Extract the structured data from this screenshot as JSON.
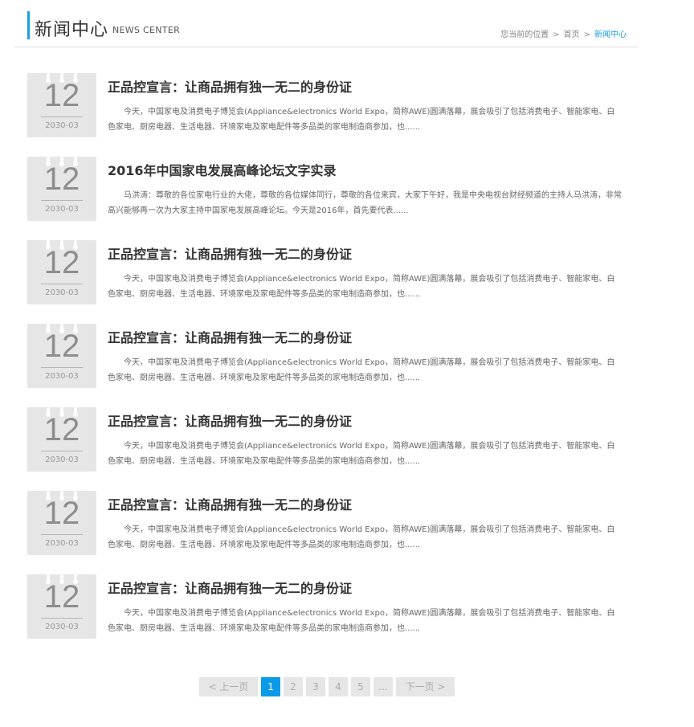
{
  "header": {
    "title": "新闻中心",
    "subtitle": "NEWS CENTER",
    "breadcrumb": {
      "location_label": "您当前的位置",
      "separator": ">",
      "home": "首页",
      "current": "新闻中心"
    }
  },
  "news": [
    {
      "day": "12",
      "year_month": "2030-03",
      "title": "正品控宣言：让商品拥有独一无二的身份证",
      "summary": "今天，中国家电及消费电子博览会(Appliance&electronics World Expo，简称AWE)圆满落幕，展会吸引了包括消费电子、智能家电、白色家电、厨房电器、生活电器、环境家电及家电配件等多品类的家电制造商参加，也......"
    },
    {
      "day": "12",
      "year_month": "2030-03",
      "title": "2016年中国家电发展高峰论坛文字实录",
      "summary": "马洪涛：尊敬的各位家电行业的大佬，尊敬的各位媒体同行，尊敬的各位来宾，大家下午好，我是中央电视台财经频道的主持人马洪涛，非常高兴能够再一次为大家主持中国家电发展高峰论坛。今天是2016年，首先要代表......"
    },
    {
      "day": "12",
      "year_month": "2030-03",
      "title": "正品控宣言：让商品拥有独一无二的身份证",
      "summary": "今天，中国家电及消费电子博览会(Appliance&electronics World Expo，简称AWE)圆满落幕，展会吸引了包括消费电子、智能家电、白色家电、厨房电器、生活电器、环境家电及家电配件等多品类的家电制造商参加，也......"
    },
    {
      "day": "12",
      "year_month": "2030-03",
      "title": "正品控宣言：让商品拥有独一无二的身份证",
      "summary": "今天，中国家电及消费电子博览会(Appliance&electronics World Expo，简称AWE)圆满落幕，展会吸引了包括消费电子、智能家电、白色家电、厨房电器、生活电器、环境家电及家电配件等多品类的家电制造商参加，也......"
    },
    {
      "day": "12",
      "year_month": "2030-03",
      "title": "正品控宣言：让商品拥有独一无二的身份证",
      "summary": "今天，中国家电及消费电子博览会(Appliance&electronics World Expo，简称AWE)圆满落幕，展会吸引了包括消费电子、智能家电、白色家电、厨房电器、生活电器、环境家电及家电配件等多品类的家电制造商参加，也......"
    },
    {
      "day": "12",
      "year_month": "2030-03",
      "title": "正品控宣言：让商品拥有独一无二的身份证",
      "summary": "今天，中国家电及消费电子博览会(Appliance&electronics World Expo，简称AWE)圆满落幕，展会吸引了包括消费电子、智能家电、白色家电、厨房电器、生活电器、环境家电及家电配件等多品类的家电制造商参加，也......"
    },
    {
      "day": "12",
      "year_month": "2030-03",
      "title": "正品控宣言：让商品拥有独一无二的身份证",
      "summary": "今天，中国家电及消费电子博览会(Appliance&electronics World Expo，简称AWE)圆满落幕，展会吸引了包括消费电子、智能家电、白色家电、厨房电器、生活电器、环境家电及家电配件等多品类的家电制造商参加，也......"
    }
  ],
  "pagination": {
    "prev": "< 上一页",
    "pages": [
      "1",
      "2",
      "3",
      "4",
      "5"
    ],
    "current": "1",
    "ellipsis": "...",
    "next": "下一页 >"
  },
  "colors": {
    "accent": "#1a9ee6",
    "active_page": "#0a9ae8",
    "date_box": "#e6e6e6"
  }
}
